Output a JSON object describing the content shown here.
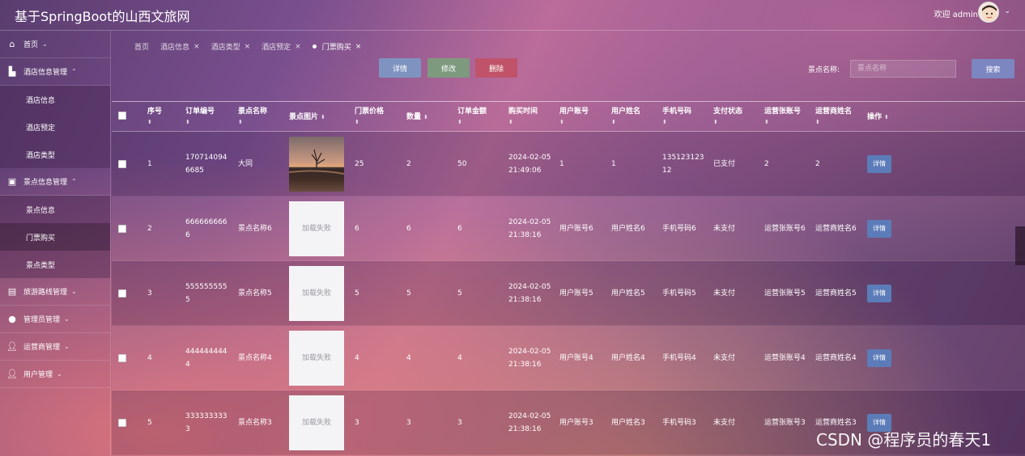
{
  "app": {
    "title": "基于SpringBoot的山西文旅网",
    "welcome": "欢迎 admin"
  },
  "sidebar": {
    "home": "首页",
    "groups": [
      {
        "label": "酒店信息管理",
        "expanded": true,
        "items": [
          "酒店信息",
          "酒店预定",
          "酒店类型"
        ]
      },
      {
        "label": "景点信息管理",
        "expanded": true,
        "items": [
          "景点信息",
          "门票购买",
          "景点类型"
        ],
        "active_item": "门票购买"
      },
      {
        "label": "旅游路线管理",
        "expanded": false,
        "items": []
      },
      {
        "label": "管理员管理",
        "expanded": false,
        "items": []
      },
      {
        "label": "运营商管理",
        "expanded": false,
        "items": []
      },
      {
        "label": "用户管理",
        "expanded": false,
        "items": []
      }
    ]
  },
  "tabs": [
    {
      "label": "首页",
      "closable": false
    },
    {
      "label": "酒店信息",
      "closable": true
    },
    {
      "label": "酒店类型",
      "closable": true
    },
    {
      "label": "酒店预定",
      "closable": true
    },
    {
      "label": "门票购买",
      "closable": true,
      "active": true
    }
  ],
  "toolbar": {
    "detail": "详情",
    "edit": "修改",
    "delete": "删除"
  },
  "search": {
    "label": "景点名称:",
    "placeholder": "景点名称",
    "button": "搜索"
  },
  "table": {
    "headers": [
      "序号",
      "订单编号",
      "景点名称",
      "景点图片",
      "门票价格",
      "数量",
      "订单金额",
      "购买时间",
      "用户账号",
      "用户姓名",
      "手机号码",
      "支付状态",
      "运营张账号",
      "运营商姓名",
      "操作"
    ],
    "image_failed_text": "加载失败",
    "action_label": "详情",
    "rows": [
      {
        "no": "1",
        "order": "1707140946685",
        "name": "大同",
        "image": "photo",
        "price": "25",
        "qty": "2",
        "amount": "50",
        "time": "2024-02-05 21:49:06",
        "account": "1",
        "username": "1",
        "phone": "13512312312",
        "status": "已支付",
        "op_account": "2",
        "op_name": "2"
      },
      {
        "no": "2",
        "order": "6666666666",
        "name": "景点名称6",
        "image": "failed",
        "price": "6",
        "qty": "6",
        "amount": "6",
        "time": "2024-02-05 21:38:16",
        "account": "用户账号6",
        "username": "用户姓名6",
        "phone": "手机号码6",
        "status": "未支付",
        "op_account": "运营张账号6",
        "op_name": "运营商姓名6"
      },
      {
        "no": "3",
        "order": "5555555555",
        "name": "景点名称5",
        "image": "failed",
        "price": "5",
        "qty": "5",
        "amount": "5",
        "time": "2024-02-05 21:38:16",
        "account": "用户账号5",
        "username": "用户姓名5",
        "phone": "手机号码5",
        "status": "未支付",
        "op_account": "运营张账号5",
        "op_name": "运营商姓名5"
      },
      {
        "no": "4",
        "order": "4444444444",
        "name": "景点名称4",
        "image": "failed",
        "price": "4",
        "qty": "4",
        "amount": "4",
        "time": "2024-02-05 21:38:16",
        "account": "用户账号4",
        "username": "用户姓名4",
        "phone": "手机号码4",
        "status": "未支付",
        "op_account": "运营张账号4",
        "op_name": "运营商姓名4"
      },
      {
        "no": "5",
        "order": "3333333333",
        "name": "景点名称3",
        "image": "failed",
        "price": "3",
        "qty": "3",
        "amount": "3",
        "time": "2024-02-05 21:38:16",
        "account": "用户账号3",
        "username": "用户姓名3",
        "phone": "手机号码3",
        "status": "未支付",
        "op_account": "运营张账号3",
        "op_name": "运营商姓名3"
      }
    ]
  },
  "watermark": "CSDN @程序员的春天1"
}
